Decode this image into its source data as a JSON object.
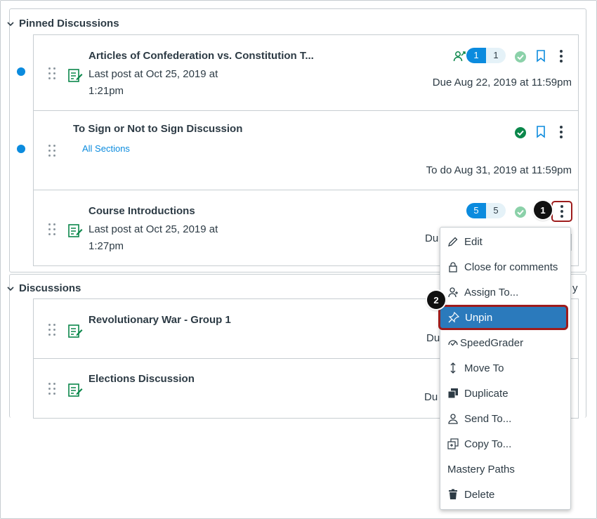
{
  "pinned": {
    "heading": "Pinned Discussions",
    "items": [
      {
        "title": "Articles of Confederation vs. Constitution T...",
        "last_post_line1": "Last post at Oct 25, 2019 at",
        "last_post_line2": "1:21pm",
        "unread_count": "1",
        "total_count": "1",
        "due": "Due Aug 22, 2019 at 11:59pm"
      },
      {
        "title": "To Sign or Not to Sign Discussion",
        "sections": "All Sections",
        "due": "To do Aug 31, 2019 at 11:59pm"
      },
      {
        "title": "Course Introductions",
        "last_post_line1": "Last post at Oct 25, 2019 at",
        "last_post_line2": "1:27pm",
        "unread_count": "5",
        "total_count": "5",
        "due_partial": "Du"
      }
    ]
  },
  "discussions": {
    "heading": "Discussions",
    "heading_tail": "y",
    "items": [
      {
        "title": "Revolutionary War - Group 1",
        "due_partial": "Du"
      },
      {
        "title": "Elections Discussion",
        "due_partial": "Du"
      }
    ]
  },
  "callouts": {
    "first": "1",
    "second": "2"
  },
  "menu": {
    "items": [
      {
        "label": "Edit",
        "icon": "pencil-icon"
      },
      {
        "label": "Close for comments",
        "icon": "lock-icon"
      },
      {
        "label": "Assign To...",
        "icon": "assign-user-icon"
      },
      {
        "label": "Unpin",
        "icon": "pin-icon"
      },
      {
        "label": "SpeedGrader",
        "icon": "speedgrader-icon"
      },
      {
        "label": "Move To",
        "icon": "move-arrows-icon"
      },
      {
        "label": "Duplicate",
        "icon": "duplicate-icon"
      },
      {
        "label": "Send To...",
        "icon": "send-user-icon"
      },
      {
        "label": "Copy To...",
        "icon": "copy-icon"
      },
      {
        "label": "Mastery Paths",
        "icon": ""
      },
      {
        "label": "Delete",
        "icon": "trash-icon"
      }
    ]
  },
  "colors": {
    "accent": "#0b8bde",
    "text": "#2d3b45",
    "published_green": "#0b874b",
    "highlight": "#2b7abc",
    "callout_border": "#9e1c1c"
  }
}
